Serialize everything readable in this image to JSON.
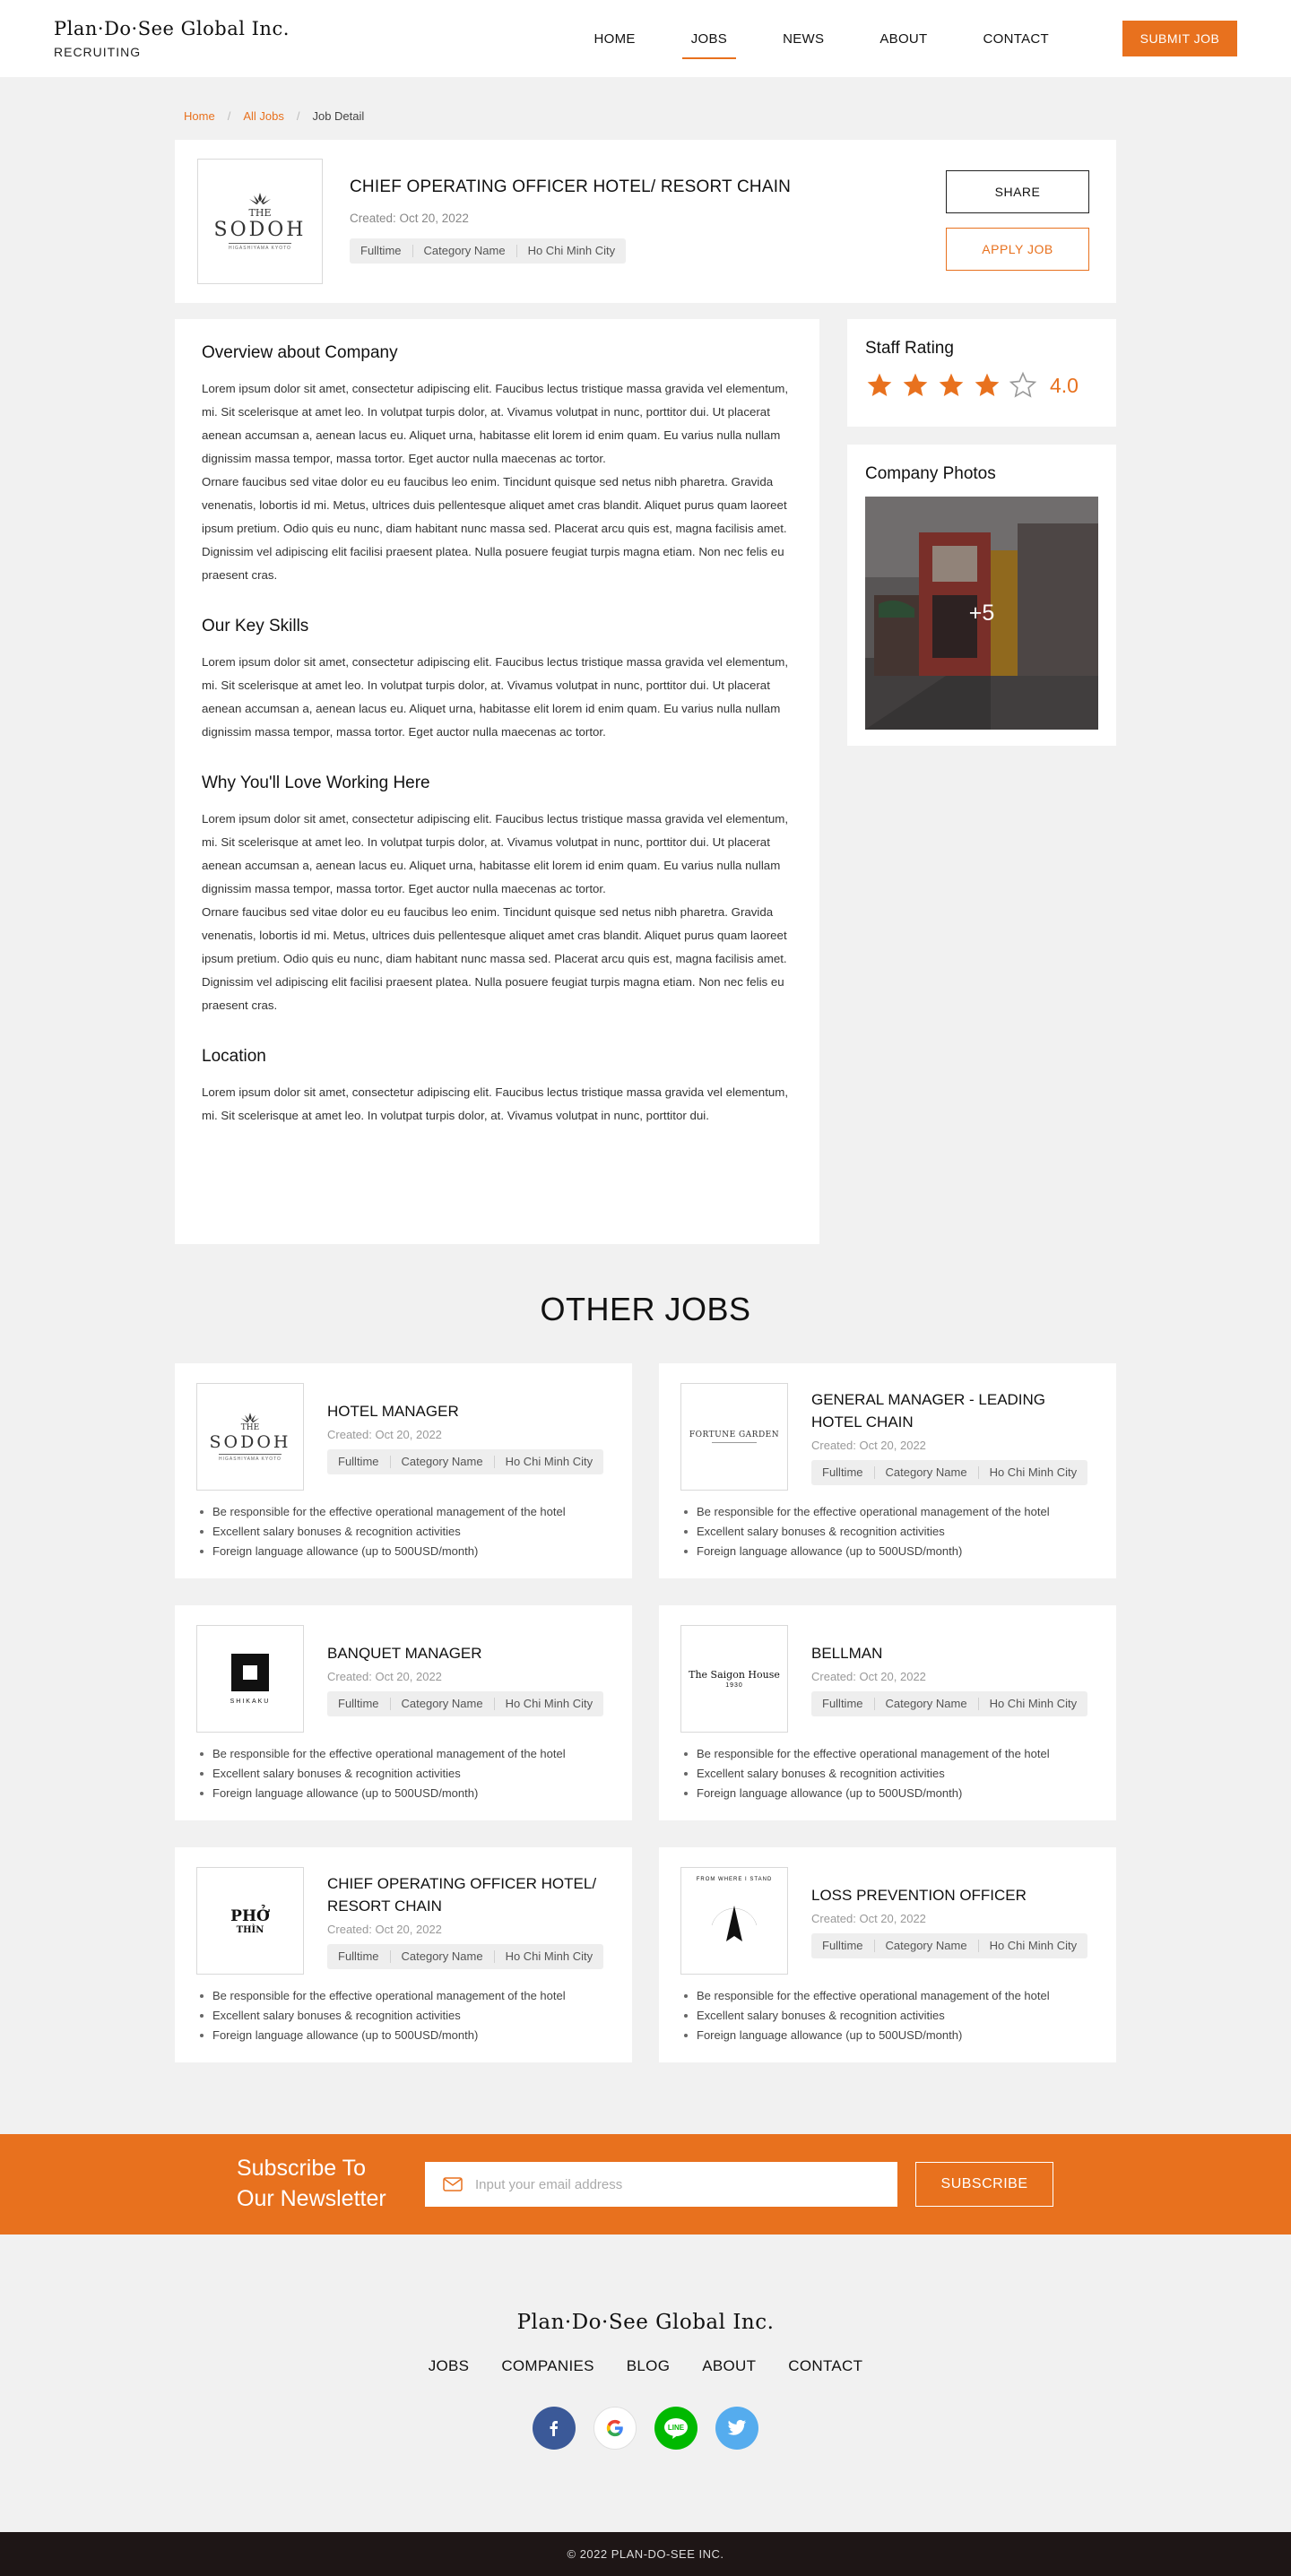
{
  "header": {
    "brand": "Plan·Do·See Global Inc.",
    "brand_sub": "RECRUITING",
    "nav": [
      "HOME",
      "JOBS",
      "NEWS",
      "ABOUT",
      "CONTACT"
    ],
    "active_nav": "JOBS",
    "submit_label": "SUBMIT JOB"
  },
  "breadcrumb": [
    "Home",
    "All Jobs",
    "Job Detail"
  ],
  "job": {
    "logo": {
      "top": "THE",
      "name": "SODOH",
      "sub": "HIGASHIYAMA KYOTO"
    },
    "title": "CHIEF OPERATING OFFICER HOTEL/ RESORT CHAIN",
    "created": "Created: Oct 20, 2022",
    "tags": [
      "Fulltime",
      "Category Name",
      "Ho Chi Minh City"
    ],
    "share_label": "SHARE",
    "apply_label": "APPLY JOB"
  },
  "sections": [
    {
      "title": "Overview about Company",
      "paragraphs": [
        "Lorem ipsum dolor sit amet, consectetur adipiscing elit. Faucibus lectus tristique massa gravida vel elementum, mi. Sit scelerisque at amet leo. In volutpat turpis dolor, at. Vivamus volutpat in nunc, porttitor dui. Ut placerat aenean accumsan a, aenean lacus eu. Aliquet urna, habitasse elit lorem id enim quam. Eu varius nulla nullam dignissim massa tempor, massa tortor. Eget auctor nulla maecenas ac tortor.",
        "Ornare faucibus sed vitae dolor eu eu faucibus leo enim. Tincidunt quisque sed netus nibh pharetra. Gravida venenatis, lobortis id mi. Metus, ultrices duis pellentesque aliquet amet cras blandit. Aliquet purus quam laoreet ipsum pretium. Odio quis eu nunc, diam habitant nunc massa sed. Placerat arcu quis est, magna facilisis amet. Dignissim vel adipiscing elit facilisi praesent platea. Nulla posuere feugiat turpis magna etiam. Non nec felis eu praesent cras."
      ]
    },
    {
      "title": "Our Key Skills",
      "paragraphs": [
        "Lorem ipsum dolor sit amet, consectetur adipiscing elit. Faucibus lectus tristique massa gravida vel elementum, mi. Sit scelerisque at amet leo. In volutpat turpis dolor, at. Vivamus volutpat in nunc, porttitor dui. Ut placerat aenean accumsan a, aenean lacus eu. Aliquet urna, habitasse elit lorem id enim quam. Eu varius nulla nullam dignissim massa tempor, massa tortor. Eget auctor nulla maecenas ac tortor."
      ]
    },
    {
      "title": "Why You'll Love Working Here",
      "paragraphs": [
        "Lorem ipsum dolor sit amet, consectetur adipiscing elit. Faucibus lectus tristique massa gravida vel elementum, mi. Sit scelerisque at amet leo. In volutpat turpis dolor, at. Vivamus volutpat in nunc, porttitor dui. Ut placerat aenean accumsan a, aenean lacus eu. Aliquet urna, habitasse elit lorem id enim quam. Eu varius nulla nullam dignissim massa tempor, massa tortor. Eget auctor nulla maecenas ac tortor.",
        "Ornare faucibus sed vitae dolor eu eu faucibus leo enim. Tincidunt quisque sed netus nibh pharetra. Gravida venenatis, lobortis id mi. Metus, ultrices duis pellentesque aliquet amet cras blandit. Aliquet purus quam laoreet ipsum pretium. Odio quis eu nunc, diam habitant nunc massa sed. Placerat arcu quis est, magna facilisis amet. Dignissim vel adipiscing elit facilisi praesent platea. Nulla posuere feugiat turpis magna etiam. Non nec felis eu praesent cras."
      ]
    },
    {
      "title": "Location",
      "paragraphs": [
        "Lorem ipsum dolor sit amet, consectetur adipiscing elit. Faucibus lectus tristique massa gravida vel elementum, mi. Sit scelerisque at amet leo. In volutpat turpis dolor, at. Vivamus volutpat in nunc, porttitor dui."
      ]
    }
  ],
  "rating": {
    "title": "Staff Rating",
    "value": "4.0",
    "stars_filled": 4,
    "stars_total": 5
  },
  "photos": {
    "title": "Company Photos",
    "more": "+5"
  },
  "other_jobs": {
    "title": "OTHER JOBS",
    "jobs": [
      {
        "title": "HOTEL MANAGER",
        "logo": "sodoh",
        "created": "Created: Oct 20, 2022",
        "tags": [
          "Fulltime",
          "Category Name",
          "Ho Chi Minh City"
        ],
        "bullets": [
          "Be responsible for the effective operational management of the hotel",
          "Excellent salary bonuses & recognition activities",
          "Foreign language allowance (up to 500USD/month)"
        ]
      },
      {
        "title": "GENERAL MANAGER - LEADING HOTEL CHAIN",
        "logo": "fortune",
        "logo_text": "FORTUNE GARDEN",
        "created": "Created: Oct 20, 2022",
        "tags": [
          "Fulltime",
          "Category Name",
          "Ho Chi Minh City"
        ],
        "bullets": [
          "Be responsible for the effective operational management of the hotel",
          "Excellent salary bonuses & recognition activities",
          "Foreign language allowance (up to 500USD/month)"
        ]
      },
      {
        "title": "BANQUET MANAGER",
        "logo": "shikaku",
        "logo_text": "SHIKAKU",
        "created": "Created: Oct 20, 2022",
        "tags": [
          "Fulltime",
          "Category Name",
          "Ho Chi Minh City"
        ],
        "bullets": [
          "Be responsible for the effective operational management of the hotel",
          "Excellent salary bonuses & recognition activities",
          "Foreign language allowance (up to 500USD/month)"
        ]
      },
      {
        "title": "BELLMAN",
        "logo": "saigon",
        "logo_text": "The Saigon House",
        "logo_sub": "1930",
        "created": "Created: Oct 20, 2022",
        "tags": [
          "Fulltime",
          "Category Name",
          "Ho Chi Minh City"
        ],
        "bullets": [
          "Be responsible for the effective operational management of the hotel",
          "Excellent salary bonuses & recognition activities",
          "Foreign language allowance (up to 500USD/month)"
        ]
      },
      {
        "title": "CHIEF OPERATING OFFICER HOTEL/ RESORT CHAIN",
        "logo": "pho",
        "logo_text": "PHỞ",
        "logo_sub": "THÌN",
        "created": "Created: Oct 20, 2022",
        "tags": [
          "Fulltime",
          "Category Name",
          "Ho Chi Minh City"
        ],
        "bullets": [
          "Be responsible for the effective operational management of the hotel",
          "Excellent salary bonuses & recognition activities",
          "Foreign language allowance (up to 500USD/month)"
        ]
      },
      {
        "title": "LOSS PREVENTION OFFICER",
        "logo": "where",
        "logo_text": "FROM WHERE I STAND",
        "created": "Created: Oct 20, 2022",
        "tags": [
          "Fulltime",
          "Category Name",
          "Ho Chi Minh City"
        ],
        "bullets": [
          "Be responsible for the effective operational management of the hotel",
          "Excellent salary bonuses & recognition activities",
          "Foreign language allowance (up to 500USD/month)"
        ]
      }
    ]
  },
  "newsletter": {
    "title_line1": "Subscribe To",
    "title_line2": "Our Newsletter",
    "placeholder": "Input your email address",
    "button": "SUBSCRIBE"
  },
  "footer": {
    "brand": "Plan·Do·See Global Inc.",
    "nav": [
      "JOBS",
      "COMPANIES",
      "BLOG",
      "ABOUT",
      "CONTACT"
    ],
    "socials": [
      "facebook-icon",
      "google-icon",
      "line-icon",
      "twitter-icon"
    ],
    "copyright": "© 2022 PLAN-DO-SEE INC."
  },
  "colors": {
    "accent": "#e8711e",
    "dark": "#1e1616",
    "facebook": "#3b5998",
    "line": "#00b900",
    "twitter": "#55acee"
  }
}
